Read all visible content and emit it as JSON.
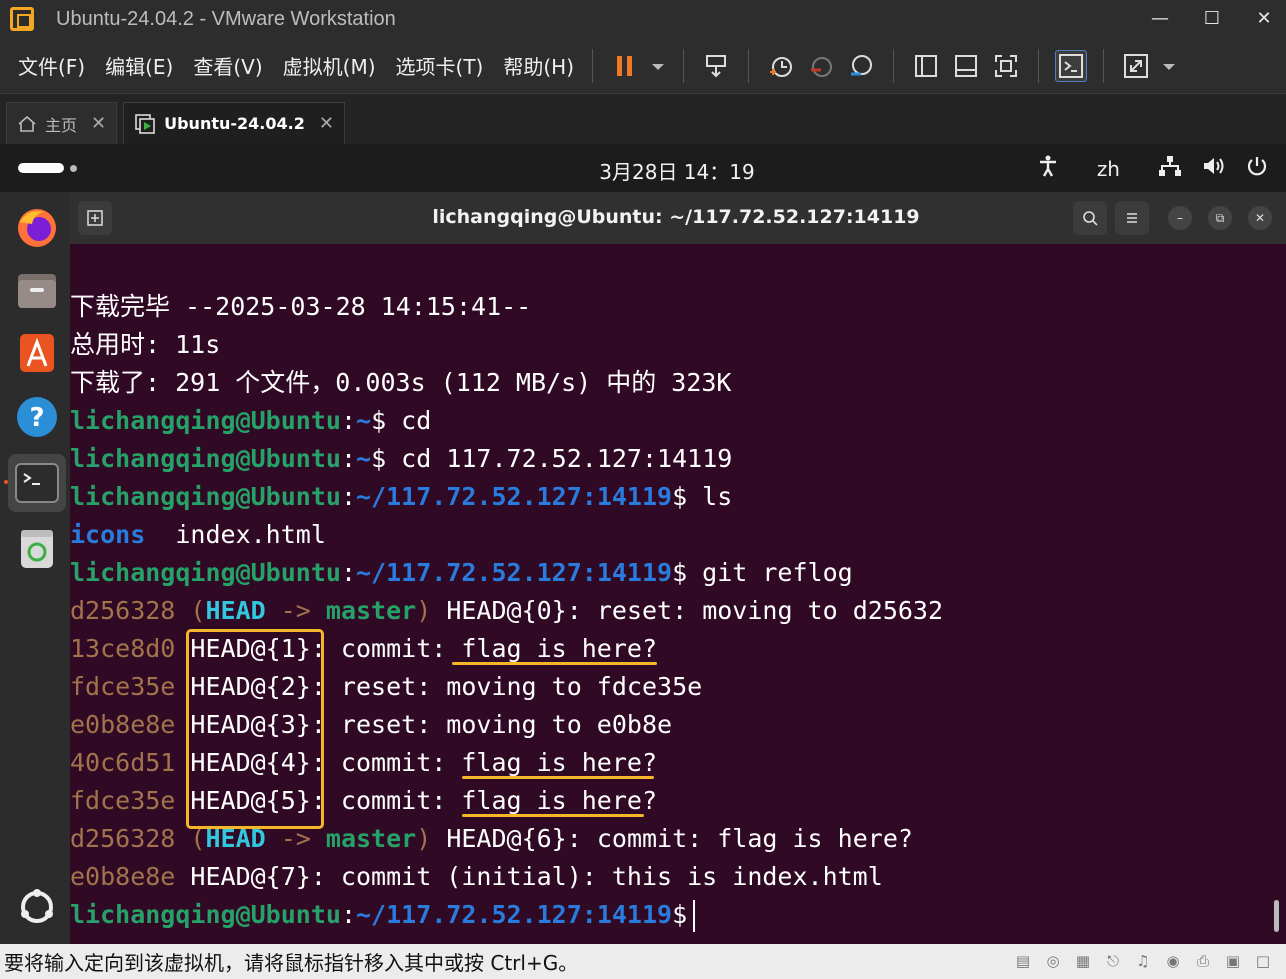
{
  "window": {
    "title": "Ubuntu-24.04.2 - VMware Workstation"
  },
  "menu": [
    "文件(F)",
    "编辑(E)",
    "查看(V)",
    "虚拟机(M)",
    "选项卡(T)",
    "帮助(H)"
  ],
  "tabs": {
    "home": "主页",
    "vm": "Ubuntu-24.04.2"
  },
  "panel": {
    "clock": "3月28日  14：19",
    "lang": "zh"
  },
  "terminal": {
    "title": "lichangqing@Ubuntu: ~/117.72.52.127:14119",
    "lines": {
      "l1": "下载完毕 --2025-03-28 14:15:41--",
      "l2": "总用时: 11s",
      "l3": "下载了: 291 个文件，0.003s (112 MB/s) 中的 323K",
      "user": "lichangqing@Ubuntu",
      "colon": ":",
      "home": "~",
      "path": "~/117.72.52.127:14119",
      "cmd_cd": "$ cd",
      "cmd_cd2": "$ cd 117.72.52.127:14119",
      "cmd_ls": "$ ls",
      "ls_dir": "icons",
      "ls_file": "  index.html",
      "cmd_reflog": "$ git reflog",
      "dollar": "$"
    },
    "reflog": [
      {
        "hash": "d256328",
        "rest": "HEAD@{0}: reset: moving to d25632"
      },
      {
        "hash": "13ce8d0",
        "rest": "HEAD@{1}: commit: flag is here?"
      },
      {
        "hash": "fdce35e",
        "rest": "HEAD@{2}: reset: moving to fdce35e"
      },
      {
        "hash": "e0b8e8e",
        "rest": "HEAD@{3}: reset: moving to e0b8e"
      },
      {
        "hash": "40c6d51",
        "rest": "HEAD@{4}: commit: flag is here?"
      },
      {
        "hash": "fdce35e",
        "rest": "HEAD@{5}: commit: flag is here?"
      },
      {
        "hash": "d256328",
        "rest": "HEAD@{6}: commit: flag is here?"
      },
      {
        "hash": "e0b8e8e",
        "rest": "HEAD@{7}: commit (initial): this is index.html"
      }
    ],
    "deco": {
      "open": " (",
      "head": "HEAD",
      "arrow": " -> ",
      "branch": "master",
      "close": ") "
    }
  },
  "status": {
    "text": "要将输入定向到该虚拟机，请将鼠标指针移入其中或按 Ctrl+G。"
  },
  "colors": {
    "accent": "#f5b62a",
    "terminal_bg": "#300a24",
    "prompt_green": "#26a269",
    "path_blue": "#2a7bde"
  }
}
